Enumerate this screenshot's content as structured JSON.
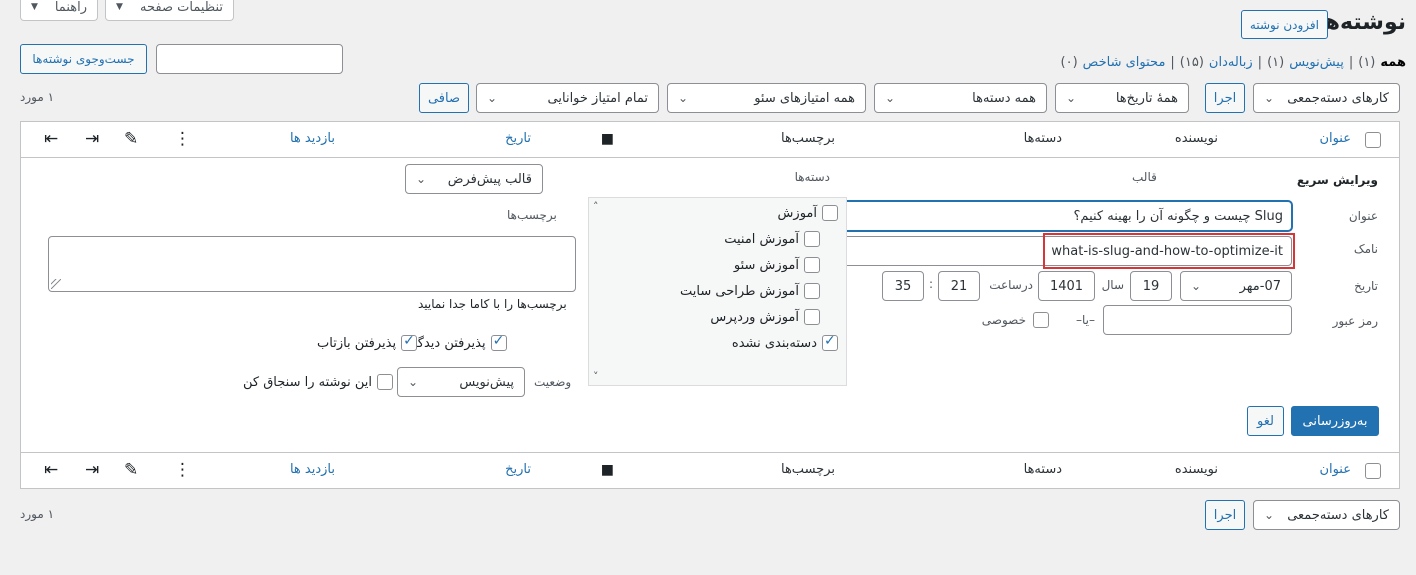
{
  "topbar": {
    "screen_options": "تنظیمات صفحه",
    "help": "راهنما"
  },
  "header": {
    "title": "نوشته‌ها",
    "add_new": "افزودن نوشته"
  },
  "views": {
    "all": "همه",
    "all_count": "(۱)",
    "drafts": "پیش‌نویس",
    "drafts_count": "(۱)",
    "trash": "زباله‌دان",
    "trash_count": "(۱۵)",
    "cornerstone": "محتوای شاخص",
    "cornerstone_count": "(۰)",
    "sep": "|"
  },
  "search": {
    "button": "جست‌وجوی نوشته‌ها",
    "value": ""
  },
  "filters": {
    "bulk_actions": "کارهای دسته‌جمعی",
    "apply": "اجرا",
    "dates": "همهٔ تاریخ‌ها",
    "categories": "همه دسته‌ها",
    "seo": "همه امتیازهای سئو",
    "readability": "تمام امتیاز خوانایی",
    "filter_button": "صافی",
    "items_count": "۱ مورد"
  },
  "table": {
    "columns": {
      "title": "عنوان",
      "author": "نویسنده",
      "categories": "دسته‌ها",
      "tags": "برچسب‌ها",
      "date": "تاریخ",
      "views": "بازدید ها"
    },
    "icons": [
      "comments-icon",
      "seo-score-icon",
      "readability-icon",
      "links-out-icon",
      "links-in-icon"
    ]
  },
  "quick_edit": {
    "heading": "ویرایش سریع",
    "title_label": "عنوان",
    "title_value": "Slug چیست و چگونه آن را بهینه کنیم؟",
    "slug_label": "نامک",
    "slug_value": "what-is-slug-and-how-to-optimize-it",
    "date_label": "تاریخ",
    "month": "07-مهر",
    "day": "19",
    "year_label": "سال",
    "year": "1401",
    "at_label": "درساعت",
    "hour": "21",
    "colon": ":",
    "minute": "35",
    "password_label": "رمز عبور",
    "or": "–یا–",
    "private_label": "خصوصی",
    "categories_label": "دسته‌ها",
    "categories": [
      {
        "label": "آموزش",
        "checked": false
      },
      {
        "label": "آموزش امنیت",
        "checked": false
      },
      {
        "label": "آموزش سئو",
        "checked": false
      },
      {
        "label": "آموزش طراحی سایت",
        "checked": false
      },
      {
        "label": "آموزش وردپرس",
        "checked": false
      },
      {
        "label": "دسته‌بندی نشده",
        "checked": true
      }
    ],
    "template_label": "قالب",
    "template_value": "قالب پیش‌فرض",
    "tags_label": "برچسب‌ها",
    "tags_hint": "برچسب‌ها را با کاما جدا نمایید",
    "allow_comments": "پذیرفتن دیدگاه",
    "allow_pings": "پذیرفتن بازتاب",
    "status_label": "وضعیت",
    "status_value": "پیش‌نویس",
    "sticky_label": "این نوشته را سنجاق کن",
    "update_button": "به‌روزرسانی",
    "cancel_button": "لغو"
  },
  "colors": {
    "accent": "#2271b1",
    "highlight": "#d63638",
    "bg": "#f0f0f1"
  }
}
